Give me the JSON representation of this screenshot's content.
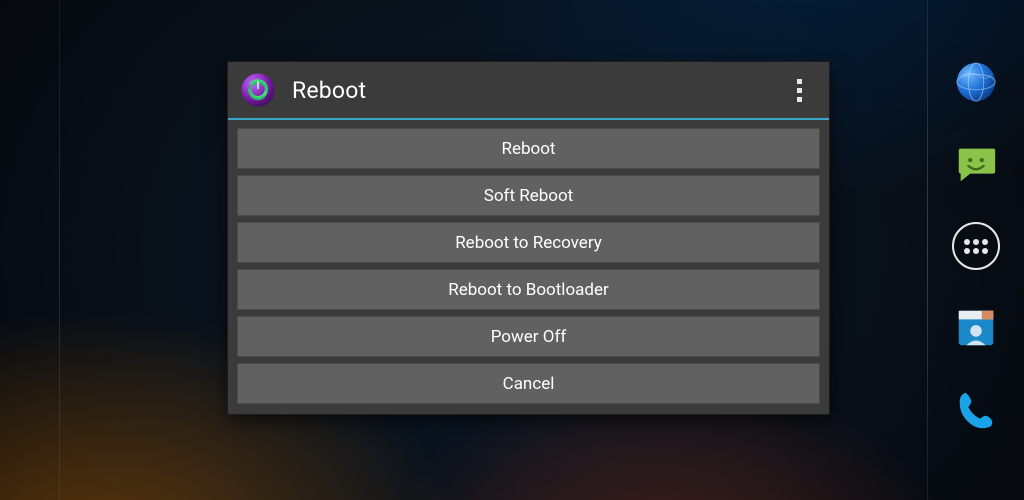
{
  "dialog": {
    "title": "Reboot",
    "options": [
      {
        "label": "Reboot"
      },
      {
        "label": "Soft Reboot"
      },
      {
        "label": "Reboot to Recovery"
      },
      {
        "label": "Reboot to Bootloader"
      },
      {
        "label": "Power Off"
      },
      {
        "label": "Cancel"
      }
    ]
  },
  "dock": {
    "items": [
      {
        "name": "browser"
      },
      {
        "name": "messaging"
      },
      {
        "name": "app-drawer"
      },
      {
        "name": "contacts"
      },
      {
        "name": "phone"
      }
    ]
  },
  "colors": {
    "accent": "#37a6c9",
    "button_bg": "#616161",
    "dialog_bg": "#3b3b3b"
  }
}
